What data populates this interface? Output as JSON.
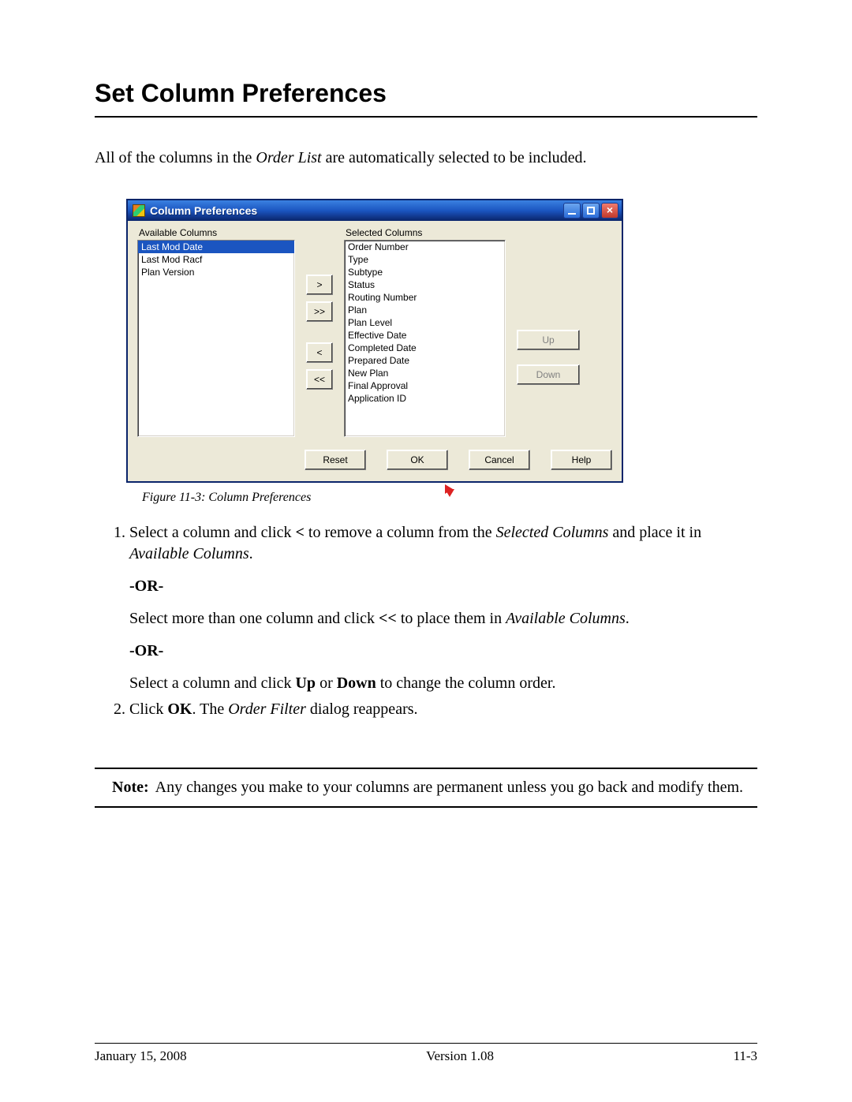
{
  "heading": "Set Column Preferences",
  "intro_before": "All of the columns in the ",
  "intro_italic": "Order List",
  "intro_after": " are automatically selected to be included.",
  "dialog": {
    "title": "Column Preferences",
    "available_label": "Available Columns",
    "selected_label": "Selected Columns",
    "available_items": [
      "Last Mod Date",
      "Last Mod Racf",
      "Plan Version"
    ],
    "available_selected_index": 0,
    "selected_items": [
      "Order Number",
      "Type",
      "Subtype",
      "Status",
      "Routing Number",
      "Plan",
      "Plan Level",
      "Effective Date",
      "Completed Date",
      "Prepared Date",
      "New Plan",
      "Final Approval",
      "Application ID"
    ],
    "move_right": ">",
    "move_all_right": ">>",
    "move_left": "<",
    "move_all_left": "<<",
    "up": "Up",
    "down": "Down",
    "reset": "Reset",
    "ok": "OK",
    "cancel": "Cancel",
    "help": "Help"
  },
  "figure_caption": "Figure 11-3:   Column Preferences",
  "step1_a": "Select a column and click ",
  "step1_b": "<",
  "step1_c": " to remove a column from the ",
  "step1_d": "Selected Columns",
  "step1_e": " and place it in ",
  "step1_f": "Available Columns",
  "step1_g": ".",
  "or": "-OR-",
  "alt1_a": "Select more than one column and click ",
  "alt1_b": "<<",
  "alt1_c": " to place them in ",
  "alt1_d": "Available Columns",
  "alt1_e": ".",
  "alt2_a": "Select a column and click ",
  "alt2_b": "Up",
  "alt2_c": " or ",
  "alt2_d": "Down",
  "alt2_e": " to change the column order.",
  "step2_a": "Click ",
  "step2_b": "OK",
  "step2_c": ". The ",
  "step2_d": "Order Filter",
  "step2_e": " dialog reappears.",
  "note_label": "Note:",
  "note_text": "Any changes you make to your columns are permanent unless you go back and modify them.",
  "footer_left": "January 15, 2008",
  "footer_center": "Version 1.08",
  "footer_right": "11-3"
}
